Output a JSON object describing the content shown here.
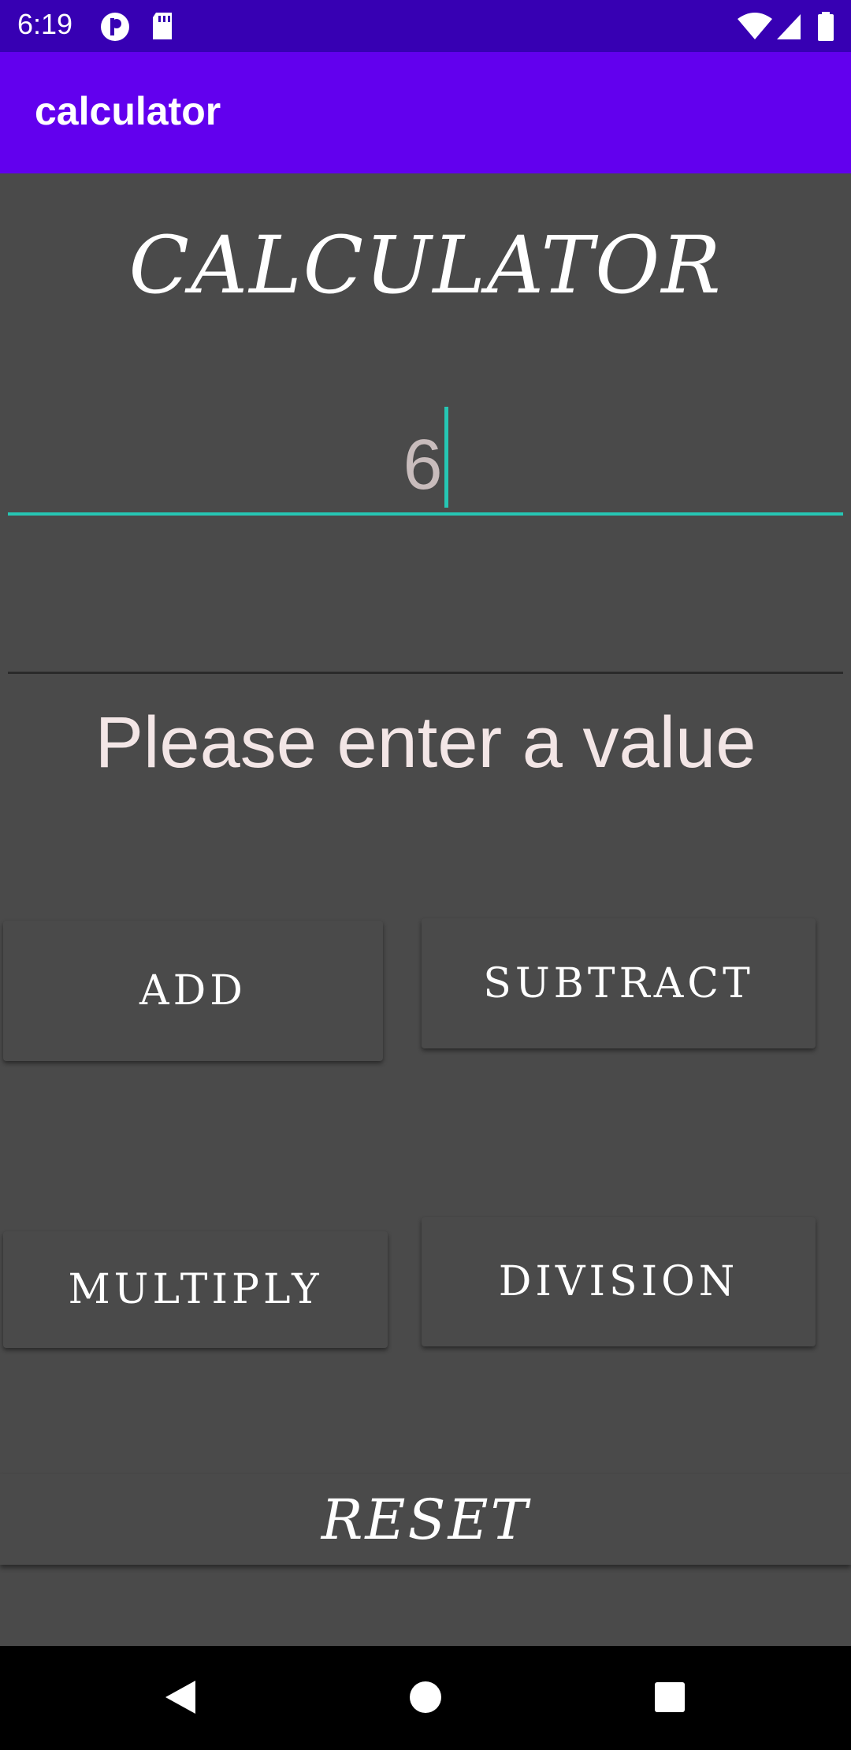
{
  "status_bar": {
    "time": "6:19",
    "icons": [
      "notification-p-icon",
      "sd-card-icon",
      "wifi-icon",
      "signal-icon",
      "battery-icon"
    ]
  },
  "app_bar": {
    "title": "calculator"
  },
  "main": {
    "heading": "CALCULATOR",
    "input1": {
      "value": "6"
    },
    "input2": {
      "value": ""
    },
    "message": "Please enter a value"
  },
  "buttons": {
    "add": "ADD",
    "subtract": "SUBTRACT",
    "multiply": "MULTIPLY",
    "division": "DIVISION",
    "reset": "RESET"
  },
  "nav_bar": {
    "icons": [
      "back-icon",
      "home-icon",
      "recents-icon"
    ]
  },
  "colors": {
    "status_bar": "#3700b3",
    "app_bar": "#6200ee",
    "background": "#4a4a4a",
    "accent": "#26c6b4"
  }
}
